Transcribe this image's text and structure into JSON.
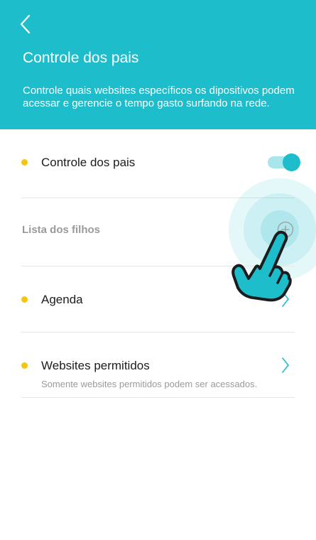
{
  "header": {
    "back_icon": "chevron-left-icon",
    "title": "Controle dos pais",
    "description": "Controle quais websites específicos os dipositivos podem acessar e gerencie o tempo gasto surfando na rede."
  },
  "settings": {
    "parental_control": {
      "label": "Controle dos pais",
      "enabled": true
    },
    "children_list": {
      "label": "Lista dos filhos",
      "add_icon": "plus-circle-icon"
    },
    "schedule": {
      "label": "Agenda",
      "icon": "chevron-right-icon"
    },
    "allowed_websites": {
      "label": "Websites permitidos",
      "description": "Somente websites permitidos podem ser acessados.",
      "icon": "chevron-right-icon"
    }
  },
  "overlay": {
    "gesture_icon": "tap-hand-icon"
  },
  "colors": {
    "accent": "#1ebdcc",
    "dot": "#f5c40e",
    "toggle_track": "#a8e6ec",
    "text": "#1c1c1c",
    "muted": "#9a9a9a"
  }
}
